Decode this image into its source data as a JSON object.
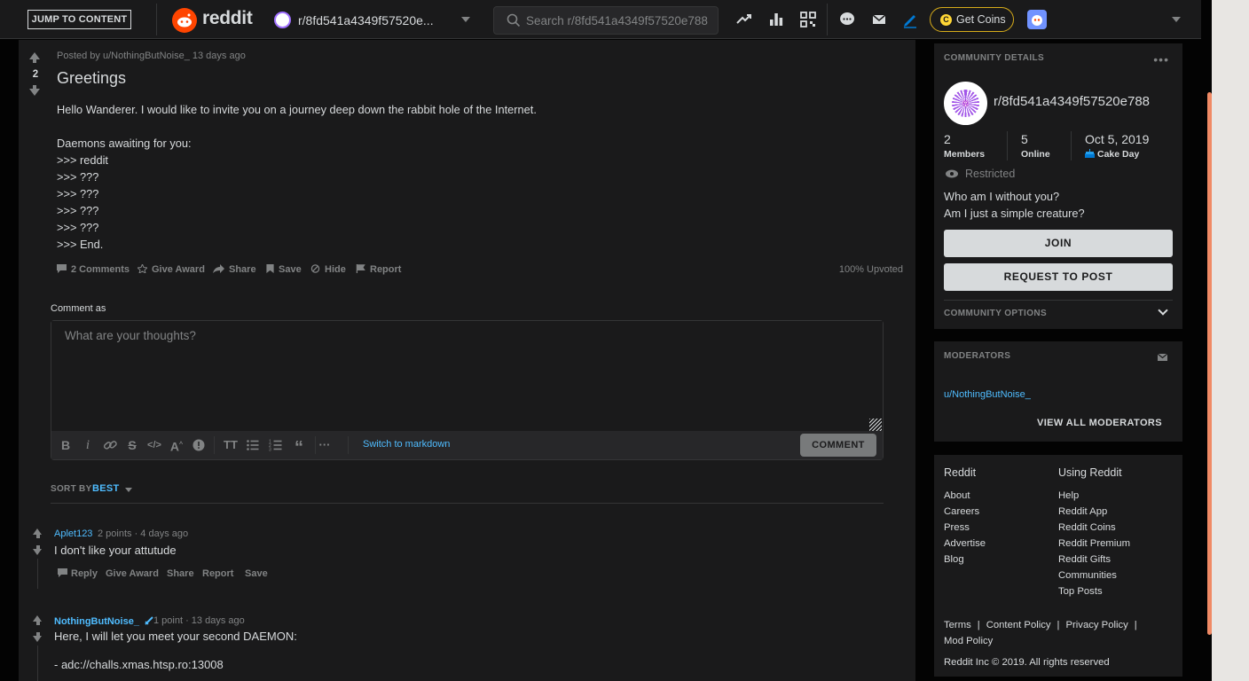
{
  "topbar": {
    "jump_label": "JUMP TO CONTENT",
    "logo_text": "reddit",
    "subreddit_short": "r/8fd541a4349f57520e...",
    "search_placeholder": "Search r/8fd541a4349f57520e788",
    "get_coins": "Get Coins",
    "icons": [
      "popular-icon",
      "stats-icon",
      "qr-code-icon",
      "chat-icon",
      "mail-icon",
      "pencil-icon",
      "coin-icon",
      "avatar-icon",
      "chevron-down-icon"
    ]
  },
  "post": {
    "score": "2",
    "meta": "Posted by u/NothingButNoise_ 13 days ago",
    "title": "Greetings",
    "body": [
      "Hello Wanderer. I would like to invite you on a journey deep down the rabbit hole of the Internet.",
      "",
      "Daemons awaiting for you:",
      ">>> reddit",
      ">>> ???",
      ">>> ???",
      ">>> ???",
      ">>> ???",
      ">>> End."
    ],
    "actions": {
      "comments": "2 Comments",
      "award": "Give Award",
      "share": "Share",
      "save": "Save",
      "hide": "Hide",
      "report": "Report"
    },
    "upvoted": "100% Upvoted"
  },
  "comment_box": {
    "label": "Comment as",
    "placeholder": "What are your thoughts?",
    "switch_markdown": "Switch to markdown",
    "submit": "COMMENT",
    "toolbar_icons": [
      "bold-icon",
      "italic-icon",
      "link-icon",
      "strikethrough-icon",
      "code-icon",
      "superscript-icon",
      "spoiler-icon",
      "heading-icon",
      "bulleted-list-icon",
      "numbered-list-icon",
      "quote-icon",
      "more-icon"
    ]
  },
  "sort": {
    "label": "SORT BY",
    "value": "BEST"
  },
  "comments": [
    {
      "author": "Aplet123",
      "points": "2 points · 4 days ago",
      "text": "I don't like your attutude",
      "actions": [
        "Reply",
        "Give Award",
        "Share",
        "Report",
        "Save"
      ]
    },
    {
      "author": "NothingButNoise_",
      "points": "1 point · 13 days ago",
      "text_lines": [
        "Here, I will let you meet your second DAEMON:",
        "",
        "- adc://challs.xmas.htsp.ro:13008"
      ]
    }
  ],
  "sidebar": {
    "community": {
      "heading": "COMMUNITY DETAILS",
      "name": "r/8fd541a4349f57520e788",
      "members_n": "2",
      "members_l": "Members",
      "online_n": "5",
      "online_l": "Online",
      "cake_n": "Oct 5, 2019",
      "cake_l": "Cake Day",
      "restricted": "Restricted",
      "desc_1": "Who am I without you?",
      "desc_2": "Am I just a simple creature?",
      "join": "JOIN",
      "request": "REQUEST TO POST",
      "options": "COMMUNITY OPTIONS"
    },
    "moderators": {
      "heading": "MODERATORS",
      "mod": "u/NothingButNoise_",
      "view_all": "VIEW ALL MODERATORS"
    },
    "footer": {
      "col1_head": "Reddit",
      "col1": [
        "About",
        "Careers",
        "Press",
        "Advertise",
        "Blog"
      ],
      "col2_head": "Using Reddit",
      "col2": [
        "Help",
        "Reddit App",
        "Reddit Coins",
        "Reddit Premium",
        "Reddit Gifts",
        "Communities",
        "Top Posts"
      ],
      "legal": [
        "Terms",
        "Content Policy",
        "Privacy Policy",
        "Mod Policy"
      ],
      "copyright": "Reddit Inc © 2019. All rights reserved"
    }
  },
  "colors": {
    "accent_link": "#4fbcff",
    "brand": "#ff4500",
    "coins_border": "#d7ac1a",
    "scroll_thumb": "#f08a65"
  }
}
